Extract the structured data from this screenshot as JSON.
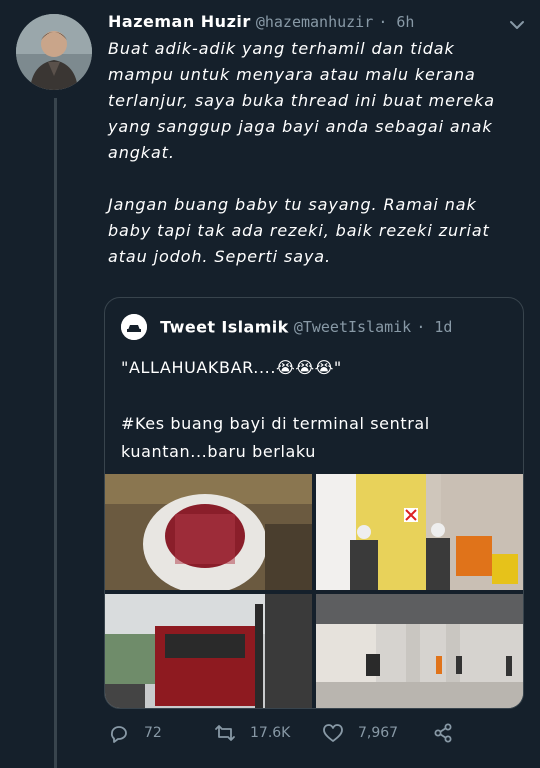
{
  "tweet": {
    "author_name": "Hazeman Huzir",
    "author_handle": "@hazemanhuzir",
    "time": "· 6h",
    "text": "Buat adik-adik yang terhamil dan tidak mampu untuk menyara atau malu kerana terlanjur, saya buka thread ini buat mereka yang sanggup jaga bayi anda sebagai anak angkat.\n\nJangan buang baby tu sayang. Ramai nak baby tapi tak ada rezeki, baik rezeki zuriat atau jodoh. Seperti saya."
  },
  "quoted": {
    "author_name": "Tweet Islamik",
    "author_handle": "@TweetIslamik",
    "time": "· 1d",
    "text": "\"ALLAHUAKBAR....😭😭😭\"\n\n#Kes buang bayi di terminal sentral kuantan...baru berlaku",
    "photos": [
      "toilet-photo",
      "firefighters-photo",
      "fire-truck-photo",
      "terminal-photo"
    ]
  },
  "actions": {
    "replies": "72",
    "retweets": "17.6K",
    "likes": "7,967"
  },
  "colors": {
    "background": "#15202b",
    "secondary_text": "#8899a6",
    "border": "#38444d"
  }
}
